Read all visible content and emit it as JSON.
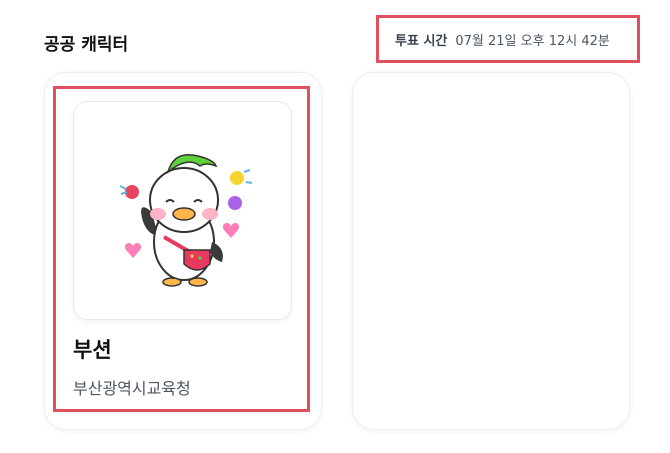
{
  "section": {
    "title": "공공 캐릭터"
  },
  "vote_time": {
    "label": "투표 시간",
    "value": "07월 21일 오후 12시 42분"
  },
  "cards": [
    {
      "name": "부션",
      "organization": "부산광역시교육청",
      "image_icon": "duck-mascot-illustration"
    }
  ],
  "colors": {
    "highlight": "#e0505e",
    "accent_green": "#5fd23b",
    "bag_pink": "#e8395f"
  }
}
